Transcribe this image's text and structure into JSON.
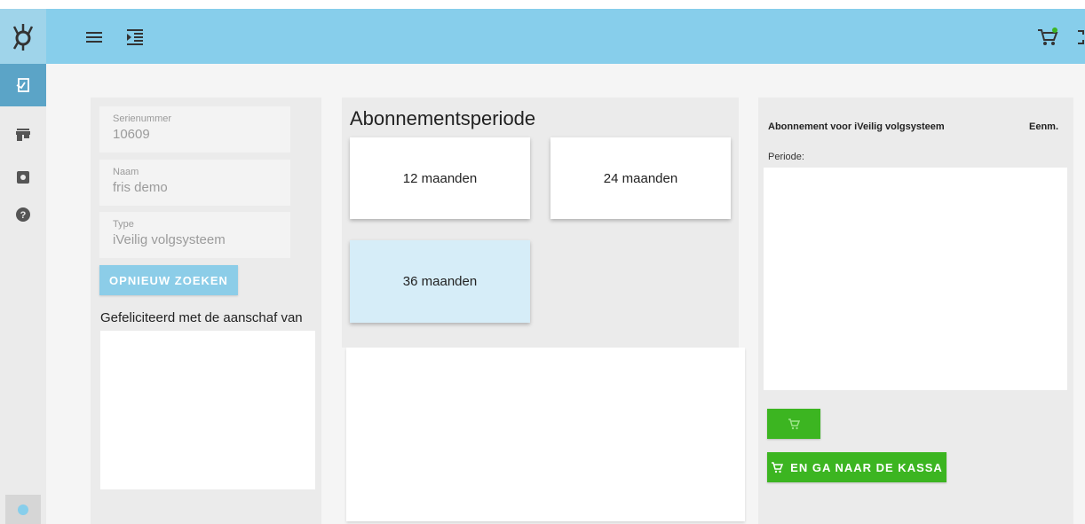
{
  "header": {
    "menu_icon": "menu-icon",
    "indent_icon": "format-indent-icon",
    "cart_icon": "cart-icon",
    "fullscreen_icon": "fullscreen-icon",
    "accent": "#87ceeb"
  },
  "sidebar": {
    "items": [
      {
        "icon": "logo-icon"
      },
      {
        "icon": "sign-in-icon",
        "active": true
      },
      {
        "icon": "store-icon"
      },
      {
        "icon": "settings-icon"
      },
      {
        "icon": "help-icon"
      }
    ]
  },
  "left": {
    "fields": [
      {
        "label": "Serienummer",
        "value": "10609"
      },
      {
        "label": "Naam",
        "value": "fris demo"
      },
      {
        "label": "Type",
        "value": "iVeilig volgsysteem"
      }
    ],
    "research_button": "OPNIEUW ZOEKEN",
    "congrats": "Gefeliciteerd met de aanschaf van"
  },
  "middle": {
    "title": "Abonnementsperiode",
    "options": [
      {
        "label": "12 maanden",
        "selected": false
      },
      {
        "label": "24 maanden",
        "selected": false
      },
      {
        "label": "36 maanden",
        "selected": true
      }
    ]
  },
  "right": {
    "subscription_title": "Abonnement voor iVeilig volgsysteem",
    "unit": "Eenm.",
    "period_label": "Periode:",
    "checkout_button": "EN GA NAAR DE KASSA",
    "button_color": "#3cb521"
  }
}
